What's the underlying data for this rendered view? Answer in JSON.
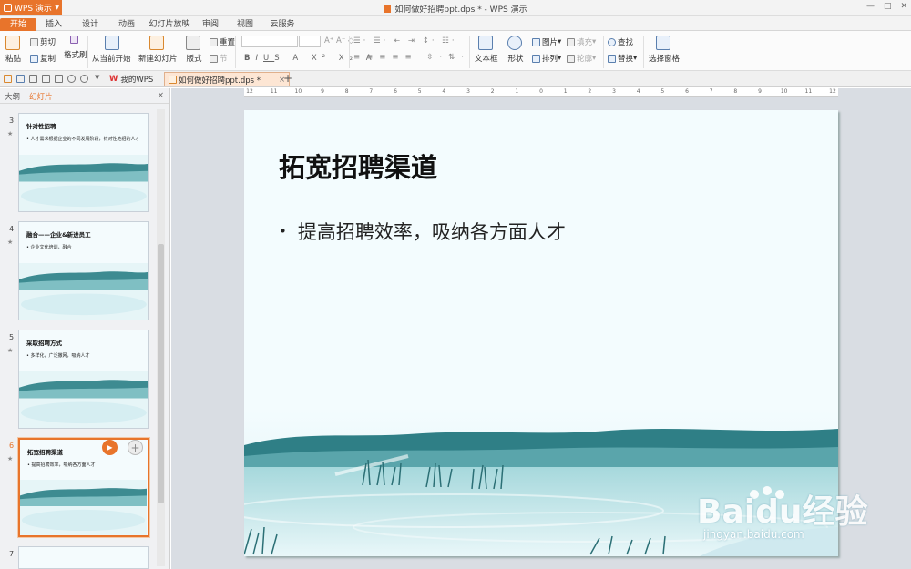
{
  "app": {
    "name": "WPS 演示",
    "window_title": "如何做好招聘ppt.dps * - WPS 演示"
  },
  "menu_tabs": [
    "开始",
    "插入",
    "设计",
    "动画",
    "幻灯片放映",
    "审阅",
    "视图",
    "云服务"
  ],
  "ribbon": {
    "paste": "粘贴",
    "cut": "剪切",
    "copy": "复制",
    "format_painter": "格式刷",
    "play_from_current": "从当前开始",
    "new_slide": "新建幻灯片",
    "layout": "版式",
    "reset": "重置",
    "section": "节",
    "textbox": "文本框",
    "shape": "形状",
    "picture": "图片",
    "arrange": "排列",
    "fill": "填充",
    "outline": "轮廓",
    "find": "查找",
    "replace": "替换",
    "select_pane": "选择窗格"
  },
  "doc_tabs": {
    "home": "我的WPS",
    "file": "如何做好招聘ppt.dps *"
  },
  "panel": {
    "outline_tab": "大纲",
    "slides_tab": "幻灯片",
    "close": "×"
  },
  "thumbnails": [
    {
      "num": "3",
      "title": "针对性招聘",
      "body": "人才需求根据企业的不同发展阶段，针对性地招的人才"
    },
    {
      "num": "4",
      "title": "融合——企业&新进员工",
      "body": "企业文化培训，融合"
    },
    {
      "num": "5",
      "title": "采取招聘方式",
      "body": "多样化，广泛撒网，吸纳人才"
    },
    {
      "num": "6",
      "title": "拓宽招聘渠道",
      "body": "提高招聘效率，吸纳各方面人才"
    },
    {
      "num": "7",
      "title": "",
      "body": ""
    }
  ],
  "slide": {
    "title": "拓宽招聘渠道",
    "bullet": "提高招聘效率，吸纳各方面人才"
  },
  "ruler_labels": [
    "12",
    "11",
    "10",
    "9",
    "8",
    "7",
    "6",
    "5",
    "4",
    "3",
    "2",
    "1",
    "0",
    "1",
    "2",
    "3",
    "4",
    "5",
    "6",
    "7",
    "8",
    "9",
    "10",
    "11",
    "12"
  ],
  "watermark": {
    "logo": "Baidu经验",
    "url": "jingyan.baidu.com"
  },
  "colors": {
    "accent": "#e8742b",
    "water": "#2f7f86"
  }
}
